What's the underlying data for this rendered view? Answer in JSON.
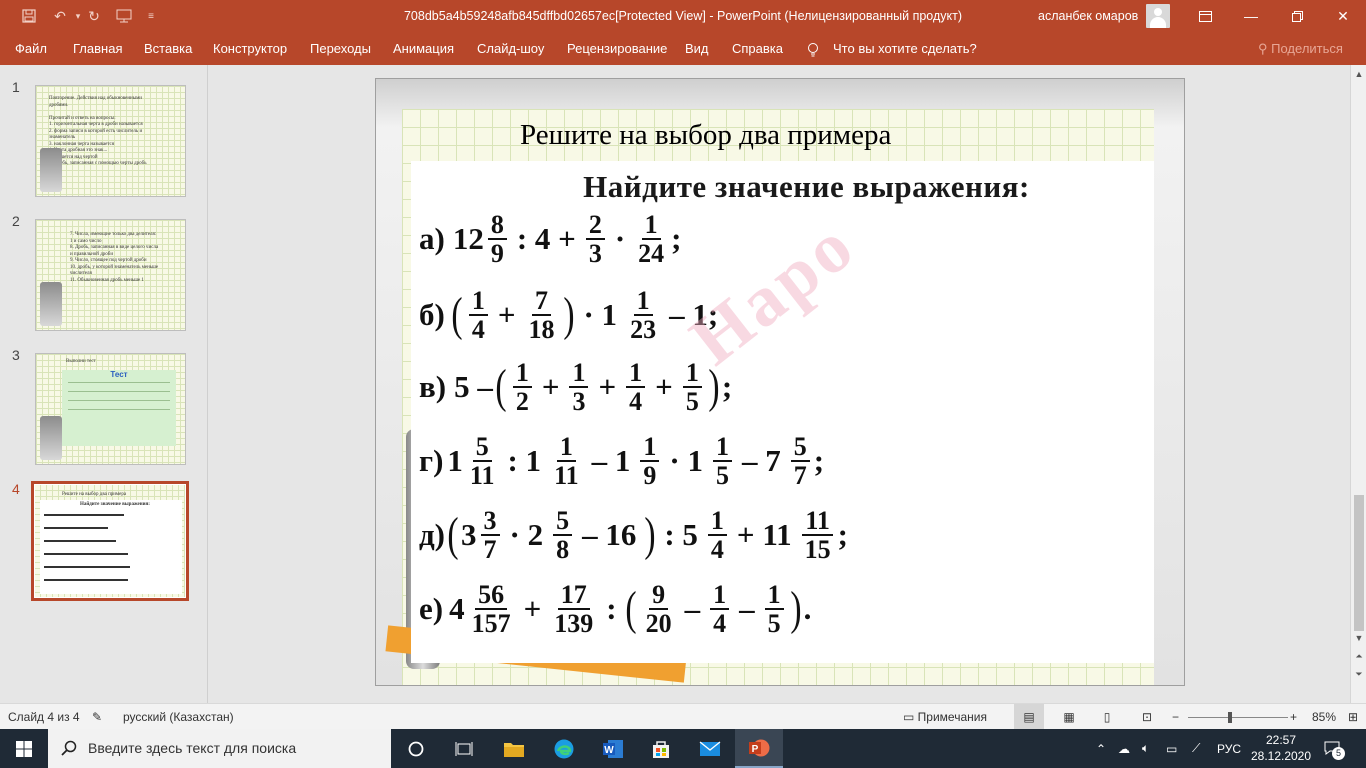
{
  "window": {
    "title": "708db5a4b59248afb845dffbd02657ec[Protected View]  -  PowerPoint (Нелицензированный продукт)",
    "user_name": "асланбек омаров"
  },
  "ribbon": {
    "tabs": [
      "Файл",
      "Главная",
      "Вставка",
      "Конструктор",
      "Переходы",
      "Анимация",
      "Слайд-шоу",
      "Рецензирование",
      "Вид",
      "Справка"
    ],
    "tell_me": "Что вы хотите сделать?",
    "share": "Поделиться"
  },
  "thumbnails": [
    {
      "number": "1",
      "lines": [
        "Повторение. Действия над обыкновенными",
        "дробями.",
        "",
        "Прочитай и ответь на вопросы:",
        "1. горизонтальная черта в дроби называется",
        "2. форма записи в которой есть числитель и",
        "знаменатель",
        "3. наклонная черта называется",
        "4. Черта дробная это знак...",
        "5. Пишется над чертой",
        "6. Дробь, записанная с помощью черты дробь"
      ]
    },
    {
      "number": "2",
      "lines": [
        "7. Числа, имеющие только два делителя:",
        "1 и само число",
        "8. Дробь, записанная в виде целого числа",
        "и правильной дроби",
        "9. Число, стоящее под чертой дроби",
        "10. дробь, у которой знаменатель меньше",
        "числителя",
        "11. Обыкновенная дробь меньше 1"
      ]
    },
    {
      "number": "3",
      "heading": "Выполни тест",
      "title": "Тест"
    },
    {
      "number": "4",
      "lines": [
        "Решите на выбор два примера",
        "Найдите значение выражения:"
      ]
    }
  ],
  "slide": {
    "title": "Решите на выбор два примера",
    "task_heading": "Найдите значение выражения:",
    "watermark": "Наро",
    "items": {
      "a": {
        "label": "а)",
        "whole": "12",
        "f1n": "8",
        "f1d": "9",
        "op1": ": 4 +",
        "f2n": "2",
        "f2d": "3",
        "op2": "·",
        "f3n": "1",
        "f3d": "24",
        "end": ";"
      },
      "b": {
        "label": "б)",
        "f1n": "1",
        "f1d": "4",
        "op1": "+",
        "f2n": "7",
        "f2d": "18",
        "op2": "· 1",
        "f3n": "1",
        "f3d": "23",
        "end": "– 1;"
      },
      "v": {
        "label": "в)",
        "start": "5 –",
        "f1n": "1",
        "f1d": "2",
        "f2n": "1",
        "f2d": "3",
        "f3n": "1",
        "f3d": "4",
        "f4n": "1",
        "f4d": "5",
        "plus": "+",
        "end": ";"
      },
      "g": {
        "label": "г)",
        "w1": "1",
        "f1n": "5",
        "f1d": "11",
        "op1": ": 1",
        "f2n": "1",
        "f2d": "11",
        "op2": "– 1",
        "f3n": "1",
        "f3d": "9",
        "op3": "· 1",
        "f4n": "1",
        "f4d": "5",
        "op4": "– 7",
        "f5n": "5",
        "f5d": "7",
        "end": ";"
      },
      "d": {
        "label": "д)",
        "w1": "3",
        "f1n": "3",
        "f1d": "7",
        "op1": "· 2",
        "f2n": "5",
        "f2d": "8",
        "op2": "– 16",
        "op3": ": 5",
        "f3n": "1",
        "f3d": "4",
        "op4": "+ 11",
        "f4n": "11",
        "f4d": "15",
        "end": ";"
      },
      "e": {
        "label": "е)",
        "w1": "4",
        "f1n": "56",
        "f1d": "157",
        "op1": "+",
        "f2n": "17",
        "f2d": "139",
        "op2": ":",
        "f3n": "9",
        "f3d": "20",
        "minus": "–",
        "f4n": "1",
        "f4d": "4",
        "f5n": "1",
        "f5d": "5",
        "end": "."
      }
    }
  },
  "status": {
    "slide_info": "Слайд 4 из 4",
    "language": "русский (Казахстан)",
    "notes": "Примечания",
    "zoom": "85%",
    "zoom_level_percent": 85
  },
  "taskbar": {
    "search_placeholder": "Введите здесь текст для поиска",
    "lang": "РУС",
    "time": "22:57",
    "date": "28.12.2020",
    "notifications": "5"
  }
}
